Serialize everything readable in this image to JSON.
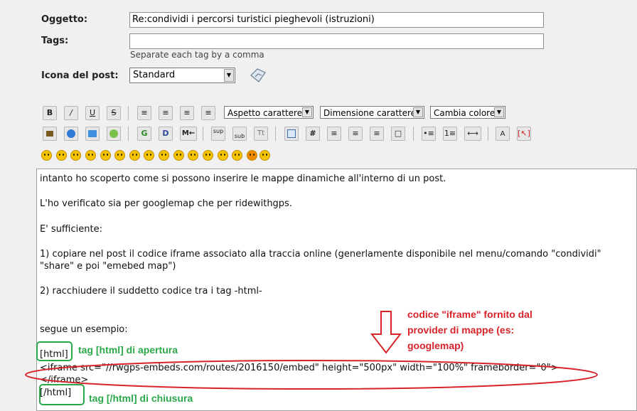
{
  "form": {
    "subject_label": "Oggetto:",
    "subject_value": "Re:condividi i percorsi turistici pieghevoli (istruzioni)",
    "tags_label": "Tags:",
    "tags_value": "",
    "tags_hint": "Separate each tag by a comma",
    "icon_label": "Icona del post:",
    "icon_value": "Standard"
  },
  "toolbar": {
    "bold": "B",
    "italic": "/",
    "underline": "U",
    "strike": "S",
    "font_face": "Aspetto carattere",
    "font_size": "Dimensione carattere",
    "font_color": "Cambia colore",
    "google": "G",
    "d": "D",
    "more": "M←",
    "sup": "sup",
    "sub": "sub",
    "tt": "Tt",
    "hash": "#"
  },
  "editor": {
    "lines": [
      "intanto ho scoperto come si possono inserire le mappe dinamiche all'interno di un post.",
      "L'ho verificato sia per googlemap che per ridewithgps.",
      "E' sufficiente:",
      "1) copiare nel post il codice iframe associato alla traccia online (generlamente disponibile nel menu/comando \"condividi\"",
      "\"share\" e poi \"emebed map\")",
      "2)  racchiudere il suddetto codice tra i tag -html-",
      "segue un esempio:",
      "[html]",
      "<iframe src=\"//rwgps-embeds.com/routes/2016150/embed\" height=\"500px\" width=\"100%\" frameborder=\"0\">",
      "</iframe>",
      "[/html]"
    ]
  },
  "annotations": {
    "red_1": "codice \"iframe\" fornito dal",
    "red_2": "provider di mappe (es:",
    "red_3": "googlemap)",
    "green_open": "tag [html] di apertura",
    "green_close": "tag [/html] di chiusura"
  },
  "colors": {
    "annotation_red": "#d8232a",
    "annotation_green": "#2aa84a"
  }
}
